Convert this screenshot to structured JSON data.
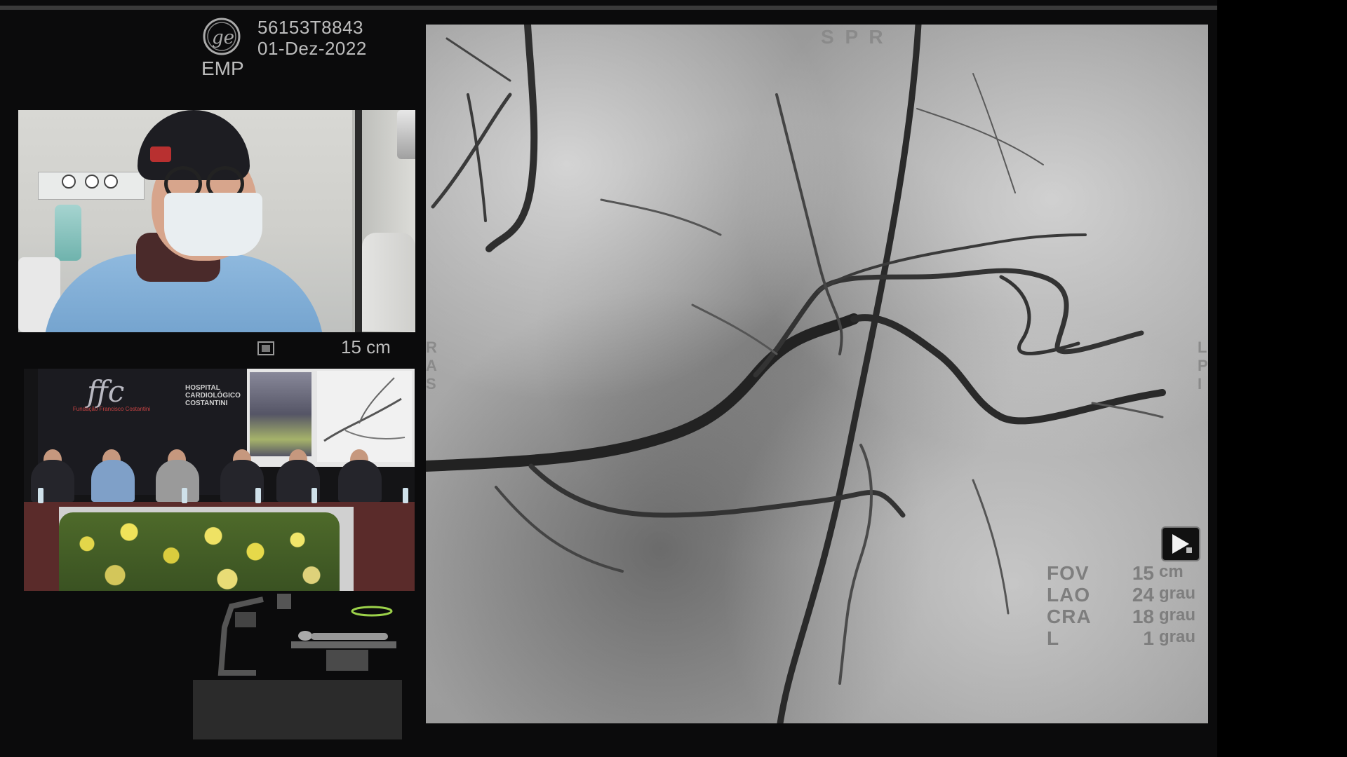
{
  "header": {
    "patient_id": "56153T8843",
    "date": "01-Dez-2022",
    "emp_label": "EMP"
  },
  "monitor": {
    "field_of_view": "15 cm"
  },
  "auditorium": {
    "logo_text": "ffc",
    "logo_subtitle": "Fundação Francisco Costantini",
    "hospital": "HOSPITAL CARDIOLÓGICO COSTANTINI"
  },
  "angio": {
    "orientation_top": "S P R",
    "orientation_left": "R A S",
    "orientation_right": "L P I",
    "params": [
      {
        "key": "FOV",
        "value": "15",
        "unit": "cm"
      },
      {
        "key": "LAO",
        "value": "24",
        "unit": "grau"
      },
      {
        "key": "CRA",
        "value": "18",
        "unit": "grau"
      },
      {
        "key": "L",
        "value": "1",
        "unit": "grau"
      }
    ]
  },
  "colors": {
    "background": "#0b0b0c",
    "overlay_text": "#bdbdbd",
    "angio_label": "#7e7e7e"
  },
  "icons": [
    "ge-logo-icon",
    "camera-view-icon",
    "play-icon",
    "c-arm-diagram-icon"
  ]
}
